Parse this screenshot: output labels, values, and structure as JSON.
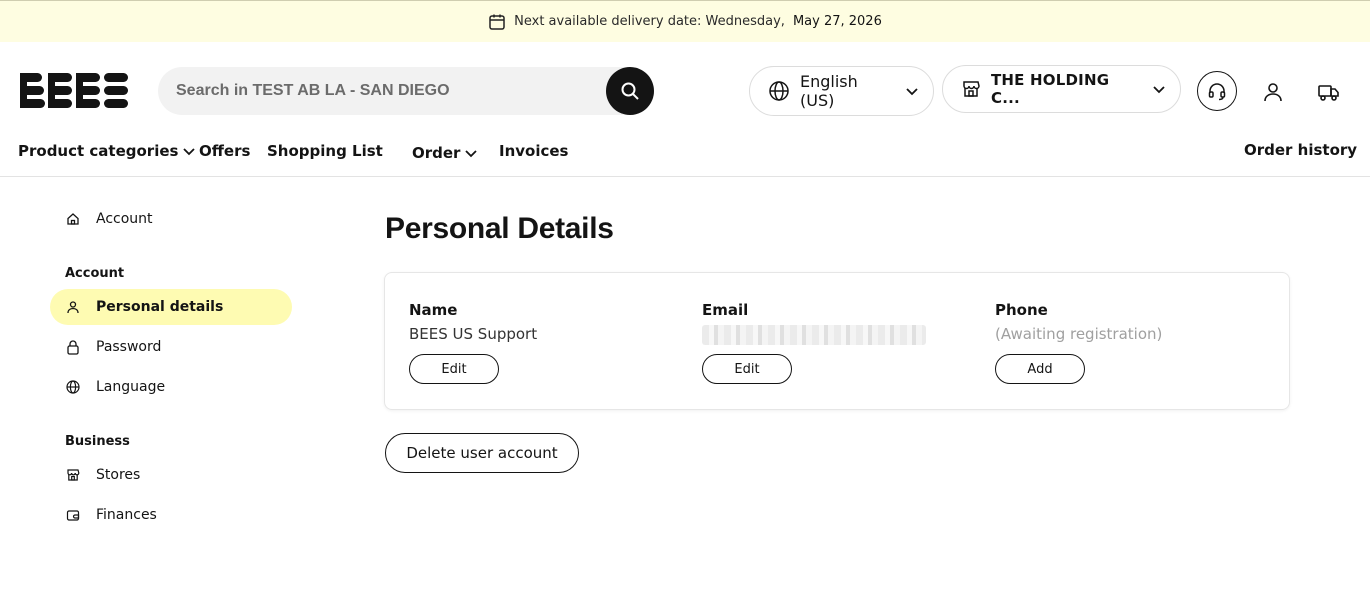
{
  "banner": {
    "prefix": "Next available delivery date: Wednesday,",
    "date": "May 27, 2026"
  },
  "header": {
    "logo_text": "BEES",
    "search_placeholder": "Search in TEST AB LA - SAN DIEGO",
    "language": "English (US)",
    "store": "THE HOLDING C..."
  },
  "nav": {
    "product_categories": "Product categories",
    "offers": "Offers",
    "shopping_list": "Shopping List",
    "order": "Order",
    "invoices": "Invoices",
    "order_history": "Order history"
  },
  "sidebar": {
    "top_item": "Account",
    "account_heading": "Account",
    "account_items": [
      "Personal details",
      "Password",
      "Language"
    ],
    "business_heading": "Business",
    "business_items": [
      "Stores",
      "Finances"
    ]
  },
  "main": {
    "title": "Personal Details",
    "name": {
      "label": "Name",
      "value": "BEES US Support",
      "button": "Edit"
    },
    "email": {
      "label": "Email",
      "button": "Edit"
    },
    "phone": {
      "label": "Phone",
      "value": "(Awaiting registration)",
      "button": "Add"
    },
    "delete_button": "Delete user account"
  },
  "colors": {
    "banner_bg": "#fefde1",
    "active_item_bg": "#fefbb2",
    "primary": "#141414"
  }
}
